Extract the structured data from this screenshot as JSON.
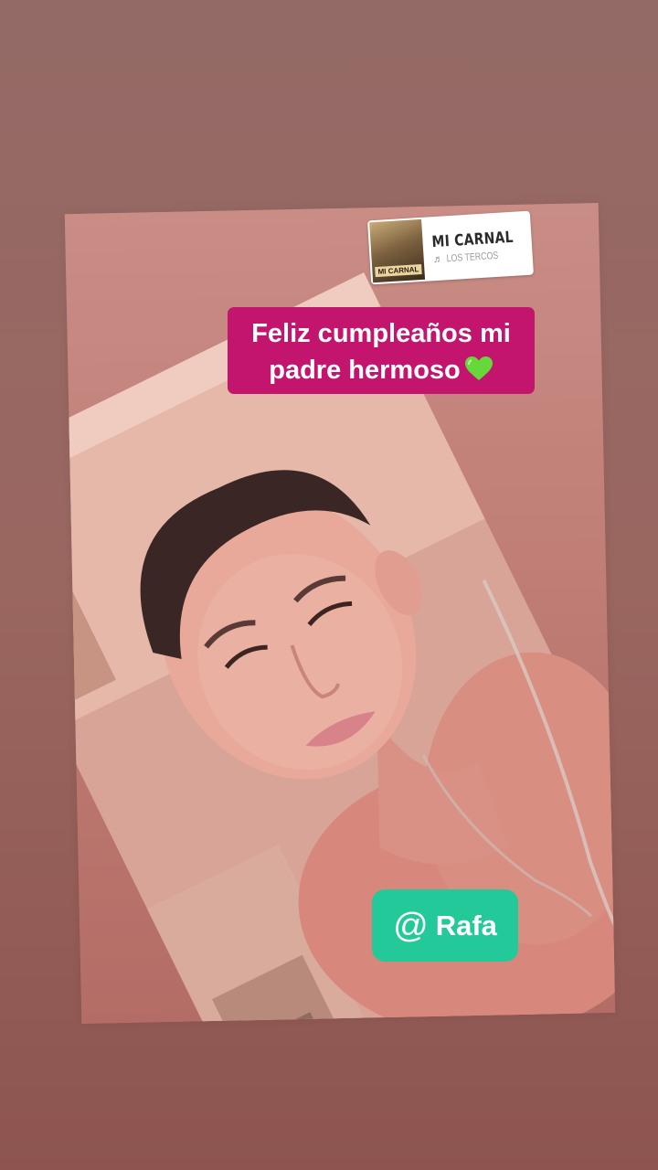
{
  "music_sticker": {
    "song": "MI CARNAL",
    "artist": "LOS TERCOS",
    "album_art_label": "MI CARNAL",
    "icon": "music-note-icon"
  },
  "caption": {
    "line1": "Feliz cumpleaños mi",
    "line2": "padre hermoso",
    "emoji": "green-heart-icon",
    "background_color": "#c3146e"
  },
  "mention": {
    "symbol": "@",
    "name": "Rafa",
    "background_color": "#24c99a"
  },
  "colors": {
    "page_background": "#946a66",
    "card_background": "#c98d86"
  }
}
